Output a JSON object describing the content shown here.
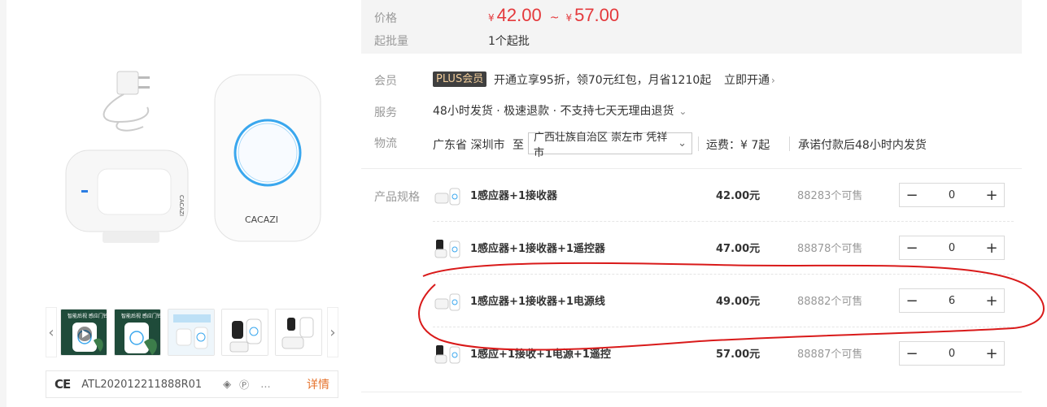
{
  "price": {
    "label": "价格",
    "yen": "¥",
    "min": "42.00",
    "tilde": "~",
    "max": "57.00",
    "moq_label": "起批量",
    "moq": "1个起批"
  },
  "member": {
    "label": "会员",
    "badge": "PLUS会员",
    "text": "开通立享95折，领70元红包，月省1210起",
    "link": "立即开通"
  },
  "service": {
    "label": "服务",
    "text": "48小时发货 · 极速退款 · 不支持七天无理由退货"
  },
  "logistics": {
    "label": "物流",
    "from": "广东省 深圳市",
    "to_label": "至",
    "destination": "广西壮族自治区 崇左市 凭祥市",
    "fee": "运费：¥ 7起",
    "note": "承诺付款后48小时内发货"
  },
  "spec": {
    "label": "产品规格",
    "items": [
      {
        "name": "1感应器+1接收器",
        "price": "42.00元",
        "stock": "88283个可售",
        "qty": "0"
      },
      {
        "name": "1感应器+1接收器+1遥控器",
        "price": "47.00元",
        "stock": "88878个可售",
        "qty": "0"
      },
      {
        "name": "1感应器+1接收器+1电源线",
        "price": "49.00元",
        "stock": "88882个可售",
        "qty": "6"
      },
      {
        "name": "1感应+1接收+1电源+1遥控",
        "price": "57.00元",
        "stock": "88887个可售",
        "qty": "0"
      }
    ]
  },
  "gallery": {
    "brand": "CACAZI",
    "thumb_text": "智能后视 感应门铃"
  },
  "cert": {
    "ce": "CE",
    "code": "ATL202012211888R01",
    "dots": "...",
    "link": "详情"
  },
  "colors": {
    "price": "#e4393c",
    "annotation": "#d91a1a",
    "link": "#e6732d"
  }
}
